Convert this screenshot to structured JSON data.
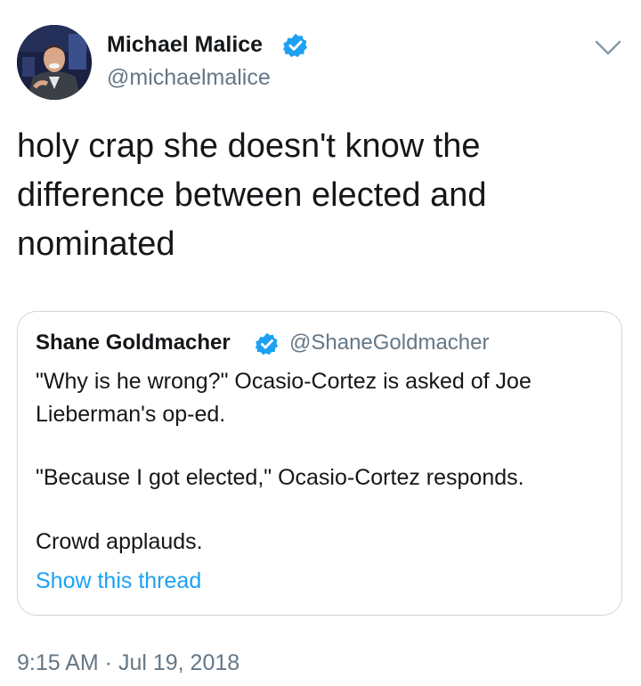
{
  "tweet": {
    "author": {
      "name": "Michael Malice",
      "handle": "@michaelmalice",
      "verified": true,
      "avatar_icon": "avatar-photo"
    },
    "menu_icon": "chevron-down-icon",
    "text_lines": [
      "holy crap she doesn't know the",
      "difference between elected and",
      "nominated"
    ],
    "quoted": {
      "author": {
        "name": "Shane Goldmacher",
        "handle": "@ShaneGoldmacher",
        "verified": true
      },
      "paragraphs": [
        [
          "\"Why is he wrong?\" Ocasio-Cortez is asked of Joe",
          "Lieberman's op-ed."
        ],
        [
          "\"Because I got elected,\" Ocasio-Cortez responds."
        ],
        [
          "Crowd applauds."
        ]
      ],
      "show_thread": "Show this thread"
    },
    "timestamp": "9:15 AM · Jul 19, 2018"
  },
  "colors": {
    "text": "#14171a",
    "secondary": "#657786",
    "accent": "#1da1f2",
    "border": "#ccd6dd"
  }
}
